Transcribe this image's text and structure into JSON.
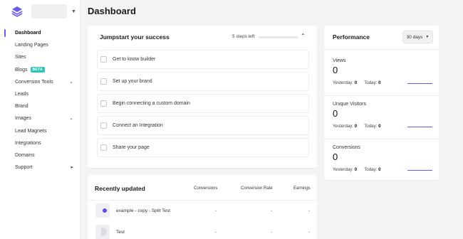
{
  "sidebar": {
    "items": [
      {
        "label": "Dashboard"
      },
      {
        "label": "Landing Pages"
      },
      {
        "label": "Sites"
      },
      {
        "label": "Blogs",
        "badge": "BETA"
      },
      {
        "label": "Conversion Tools"
      },
      {
        "label": "Leads"
      },
      {
        "label": "Brand"
      },
      {
        "label": "Images"
      },
      {
        "label": "Lead Magnets"
      },
      {
        "label": "Integrations"
      },
      {
        "label": "Domains"
      },
      {
        "label": "Support"
      }
    ]
  },
  "header": {
    "title": "Dashboard"
  },
  "jumpstart": {
    "title": "Jumpstart your success",
    "steps_left": "5 steps left",
    "progress": 0.0,
    "steps": [
      {
        "label": "Get to know builder"
      },
      {
        "label": "Set up your brand"
      },
      {
        "label": "Begin connecting a custom domain"
      },
      {
        "label": "Connect an Integration"
      },
      {
        "label": "Share your page"
      }
    ]
  },
  "performance": {
    "title": "Performance",
    "range": "30 days",
    "metrics": [
      {
        "label": "Views",
        "value": "0",
        "yesterday_label": "Yesterday:",
        "yesterday": "0",
        "today_label": "Today:",
        "today": "0"
      },
      {
        "label": "Unique Visitors",
        "value": "0",
        "yesterday_label": "Yesterday:",
        "yesterday": "0",
        "today_label": "Today:",
        "today": "0"
      },
      {
        "label": "Conversions",
        "value": "0",
        "yesterday_label": "Yesterday:",
        "yesterday": "0",
        "today_label": "Today:",
        "today": "0"
      }
    ]
  },
  "recent": {
    "title": "Recently updated",
    "columns": {
      "conversions": "Conversions",
      "conversion_rate": "Conversion Rate",
      "earnings": "Earnings"
    },
    "rows": [
      {
        "name": "example - copy - Split Test",
        "conversions": "-",
        "conversion_rate": "-",
        "earnings": "-"
      },
      {
        "name": "Test",
        "conversions": "-",
        "conversion_rate": "-",
        "earnings": "-"
      }
    ]
  },
  "colors": {
    "accent": "#6c5ce7",
    "badge": "#2ec4b6"
  }
}
